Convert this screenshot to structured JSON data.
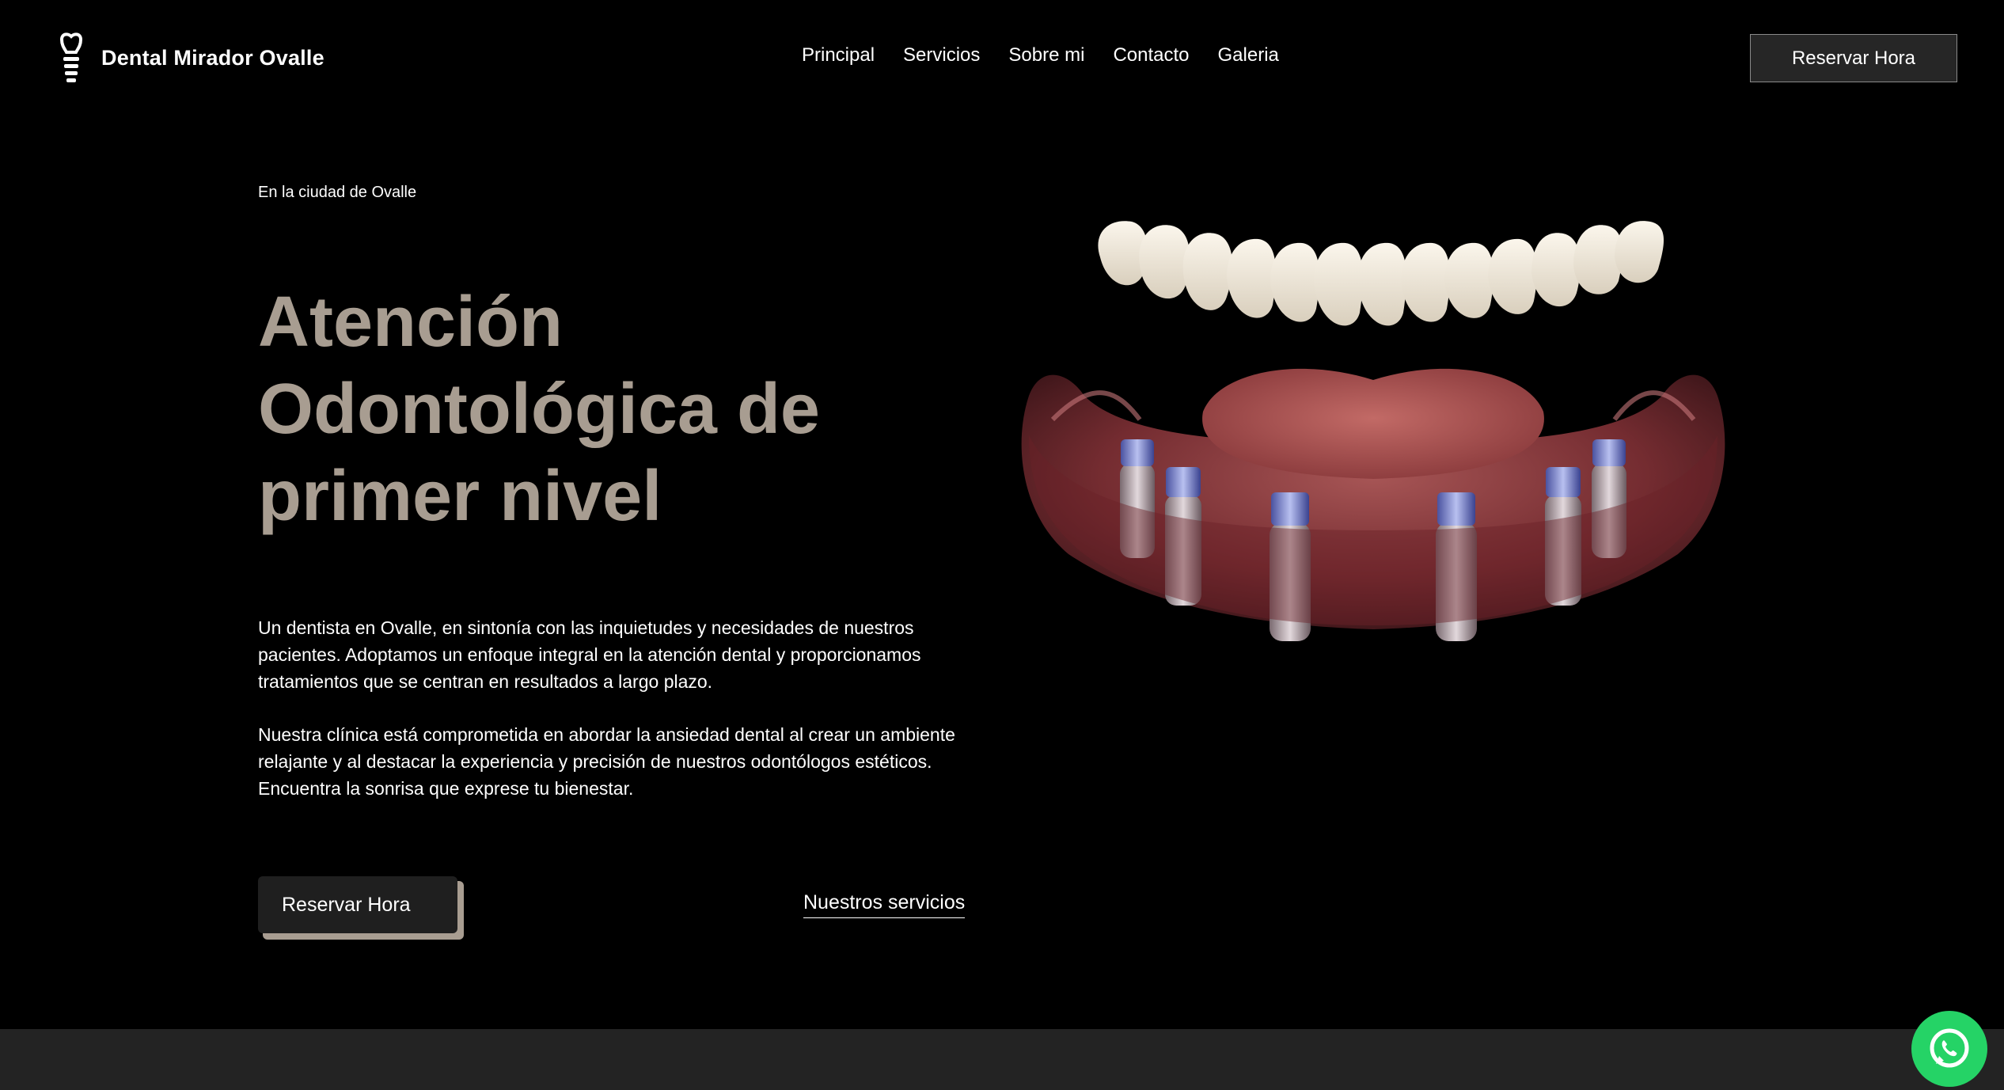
{
  "header": {
    "brand": "Dental Mirador Ovalle",
    "nav": [
      "Principal",
      "Servicios",
      "Sobre mi",
      "Contacto",
      "Galeria"
    ],
    "cta": "Reservar Hora"
  },
  "hero": {
    "eyebrow": "En la ciudad de Ovalle",
    "title_lines": [
      "Atención",
      "Odontológica de",
      "primer nivel"
    ],
    "paragraph1": "Un dentista en Ovalle, en sintonía con las inquietudes y necesidades de nuestros pacientes. Adoptamos un enfoque integral en la atención dental y proporcionamos tratamientos que se centran en resultados a largo plazo.",
    "paragraph2": "Nuestra clínica está comprometida en abordar la ansiedad dental al crear un ambiente relajante y al destacar la experiencia y precisión de nuestros odontólogos estéticos. Encuentra la sonrisa que exprese tu bienestar.",
    "primary_button": "Reservar Hora",
    "secondary_link": "Nuestros servicios"
  },
  "icons": {
    "logo": "tooth-implant-icon",
    "floating": "whatsapp-icon"
  },
  "colors": {
    "background": "#000000",
    "accent": "#a89d91",
    "whatsapp": "#25d366",
    "footer_band": "#232323"
  }
}
